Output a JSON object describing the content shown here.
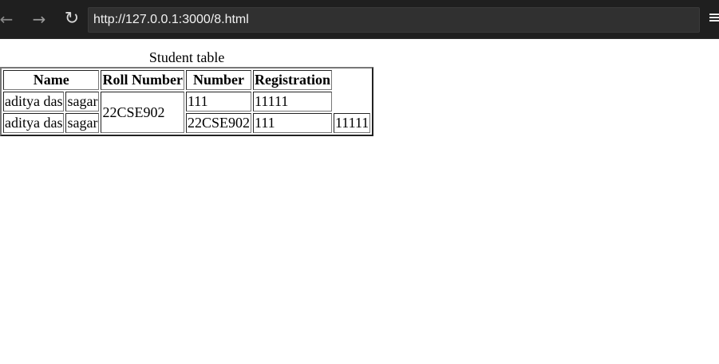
{
  "browser": {
    "back_icon": "←",
    "forward_icon": "→",
    "reload_icon": "↻",
    "url": "http://127.0.0.1:3000/8.html"
  },
  "table": {
    "caption": "Student table",
    "headers": {
      "name": "Name",
      "roll_number": "Roll Number",
      "number": "Number",
      "registration": "Registration"
    },
    "rows": [
      {
        "first_name": "aditya das",
        "last_name": "sagar",
        "roll_number": "22CSE902",
        "number": "111",
        "registration": "11111"
      },
      {
        "first_name": "aditya das",
        "last_name": "sagar",
        "roll_number": "22CSE902",
        "number": "111",
        "registration": "11111"
      }
    ]
  }
}
